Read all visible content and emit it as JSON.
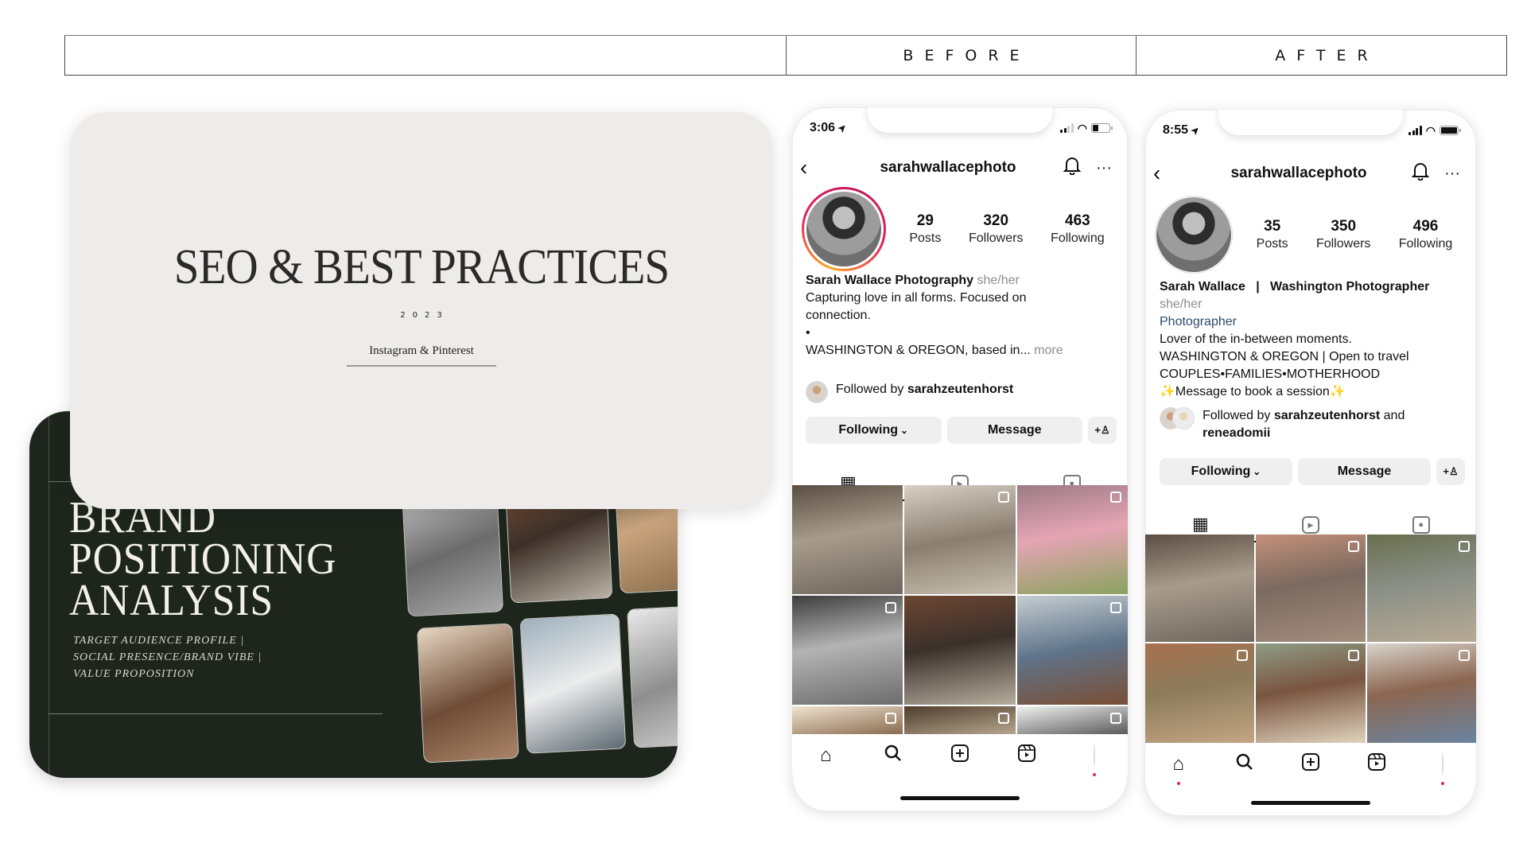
{
  "header": {
    "before_label": "BEFORE",
    "after_label": "AFTER"
  },
  "light_slide": {
    "title": "SEO & BEST PRACTICES",
    "year": "2023",
    "subtitle": "Instagram & Pinterest"
  },
  "dark_slide": {
    "title_lines": [
      "BRAND",
      "POSITIONING",
      "ANALYSIS"
    ],
    "subtitle_lines": [
      "TARGET  AUDIENCE  PROFILE  |",
      "SOCIAL PRESENCE/BRAND VIBE |",
      "VALUE PROPOSITION"
    ],
    "colors": {
      "background": "#1d251d",
      "text": "#f3f0e8"
    }
  },
  "before": {
    "status_time": "3:06",
    "username": "sarahwallacephoto",
    "stats": [
      {
        "num": "29",
        "label": "Posts"
      },
      {
        "num": "320",
        "label": "Followers"
      },
      {
        "num": "463",
        "label": "Following"
      }
    ],
    "display_name": "Sarah Wallace Photography",
    "pronouns": "she/her",
    "bio_lines": [
      "Capturing love in all forms. Focused on connection.",
      "•"
    ],
    "bio_truncated": "WASHINGTON & OREGON, based in...",
    "more_label": "more",
    "followed_prefix": "Followed by ",
    "followed_by": "sarahzeutenhorst",
    "following_btn": "Following",
    "message_btn": "Message",
    "story_ring": true
  },
  "after": {
    "status_time": "8:55",
    "username": "sarahwallacephoto",
    "stats": [
      {
        "num": "35",
        "label": "Posts"
      },
      {
        "num": "350",
        "label": "Followers"
      },
      {
        "num": "496",
        "label": "Following"
      }
    ],
    "display_name": "Sarah Wallace   |   Washington Photographer",
    "pronouns": "she/her",
    "category": "Photographer",
    "bio_lines": [
      "Lover of the in-between moments.",
      "WASHINGTON & OREGON | Open to travel",
      "COUPLES•FAMILIES•MOTHERHOOD",
      "✨Message to book a session✨"
    ],
    "followed_prefix": "Followed by ",
    "followed_by": "sarahzeutenhorst",
    "followed_and": " and ",
    "followed_by_2": "reneadomii",
    "following_btn": "Following",
    "message_btn": "Message",
    "story_ring": false
  },
  "icons": {
    "back": "‹",
    "bell": "🔔",
    "more": "···",
    "chevron_down": "⌄",
    "add_person": "+♙",
    "grid": "▦",
    "reels": "▶",
    "tagged": "👤",
    "home": "⌂",
    "search": "⚲",
    "add": "⊞",
    "location_arrow": "➤"
  },
  "colors": {
    "story_ring": [
      "#f9a825",
      "#e91e63",
      "#c2185b"
    ],
    "notification_dot": "#e0245e",
    "category_link": "#2c4a6e"
  }
}
